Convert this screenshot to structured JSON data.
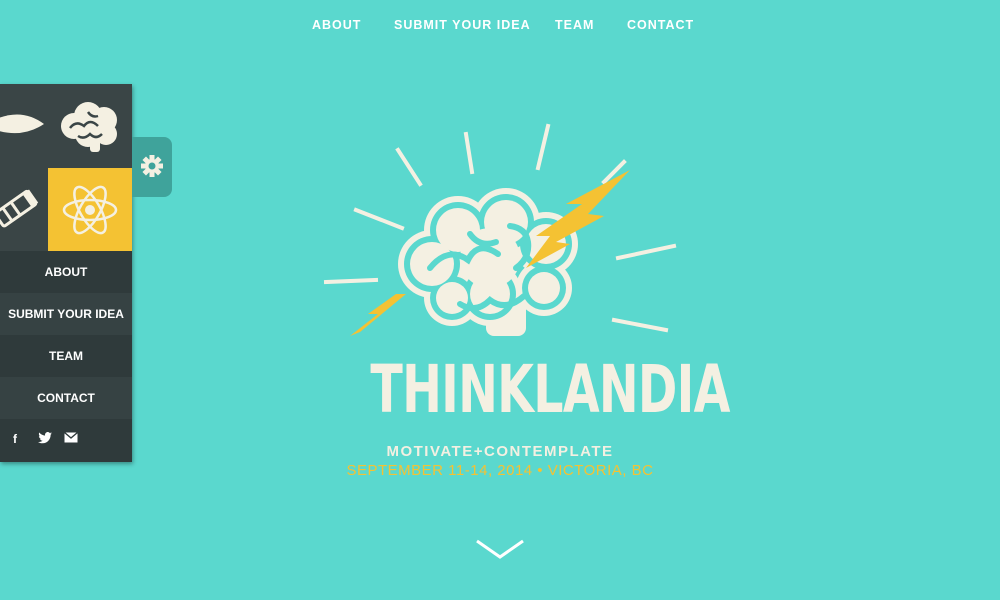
{
  "top_nav": {
    "items": [
      {
        "label": "ABOUT"
      },
      {
        "label": "SUBMIT YOUR IDEA"
      },
      {
        "label": "TEAM"
      },
      {
        "label": "CONTACT"
      }
    ]
  },
  "side_panel": {
    "tiles": [
      {
        "icon": "lightbulb-icon"
      },
      {
        "icon": "brain-icon"
      },
      {
        "icon": "pencil-icon"
      },
      {
        "icon": "atom-icon",
        "selected": true
      }
    ],
    "menu": [
      {
        "label": "ABOUT"
      },
      {
        "label": "SUBMIT YOUR IDEA"
      },
      {
        "label": "TEAM"
      },
      {
        "label": "CONTACT"
      }
    ],
    "social": [
      {
        "icon": "facebook-icon",
        "glyph": "f"
      },
      {
        "icon": "twitter-icon",
        "glyph": "🐦"
      },
      {
        "icon": "email-icon",
        "glyph": "✉"
      }
    ],
    "settings_icon": "gear-icon"
  },
  "hero": {
    "title": "THINKLANDIA",
    "tagline": "MOTIVATE+CONTEMPLATE",
    "dates": "SEPTEMBER 11-14, 2014 • VICTORIA, BC"
  },
  "scroll_icon": "chevron-down-icon",
  "colors": {
    "background": "#5ad8ce",
    "accent_yellow": "#f4c233",
    "cream": "#f4f0e2",
    "panel_dark": "#3a4546",
    "settings_tab": "#3fa39b"
  }
}
